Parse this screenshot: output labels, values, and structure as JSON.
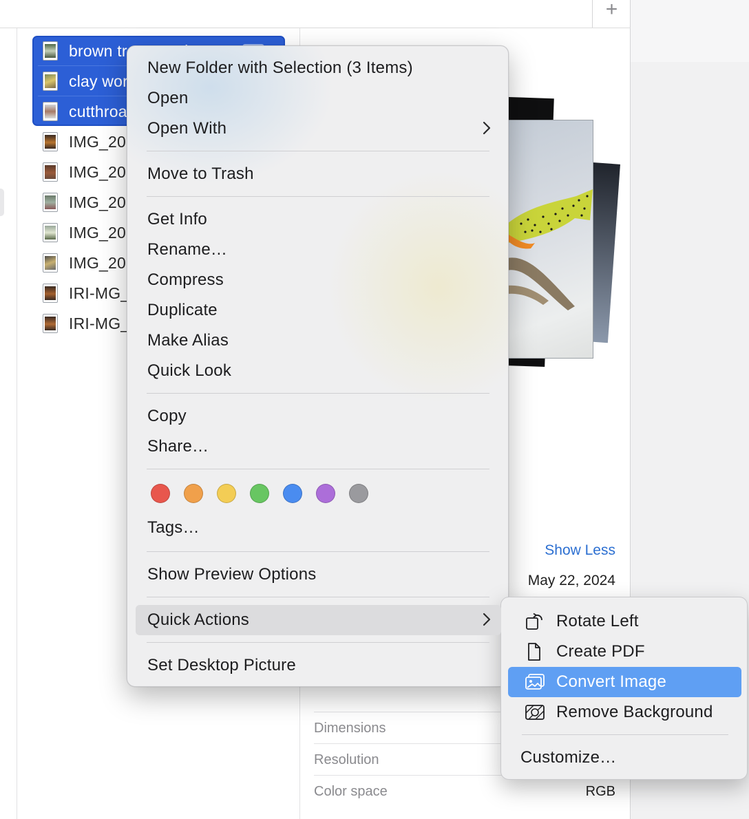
{
  "toolbar": {
    "add_label": "+"
  },
  "files": [
    {
      "name": "brown trout crush",
      "selected": true
    },
    {
      "name": "clay work",
      "selected": true
    },
    {
      "name": "cutthroat",
      "selected": true
    },
    {
      "name": "IMG_20",
      "selected": false
    },
    {
      "name": "IMG_20",
      "selected": false
    },
    {
      "name": "IMG_20",
      "selected": false
    },
    {
      "name": "IMG_20",
      "selected": false
    },
    {
      "name": "IMG_20",
      "selected": false
    },
    {
      "name": "IRI-MG_",
      "selected": false
    },
    {
      "name": "IRI-MG_",
      "selected": false
    }
  ],
  "context_menu": {
    "new_folder": "New Folder with Selection (3 Items)",
    "open": "Open",
    "open_with": "Open With",
    "move_to_trash": "Move to Trash",
    "get_info": "Get Info",
    "rename": "Rename…",
    "compress": "Compress",
    "duplicate": "Duplicate",
    "make_alias": "Make Alias",
    "quick_look": "Quick Look",
    "copy": "Copy",
    "share": "Share…",
    "tags": "Tags…",
    "show_preview_options": "Show Preview Options",
    "quick_actions": "Quick Actions",
    "set_desktop_picture": "Set Desktop Picture",
    "tag_colors": [
      {
        "name": "red",
        "color": "#e8574d"
      },
      {
        "name": "orange",
        "color": "#f0a04b"
      },
      {
        "name": "yellow",
        "color": "#f3cd55"
      },
      {
        "name": "green",
        "color": "#68c662"
      },
      {
        "name": "blue",
        "color": "#4a8cf0"
      },
      {
        "name": "purple",
        "color": "#ac6ed9"
      },
      {
        "name": "gray",
        "color": "#9a9a9e"
      }
    ]
  },
  "quick_actions_menu": {
    "rotate_left": "Rotate Left",
    "create_pdf": "Create PDF",
    "convert_image": "Convert Image",
    "remove_background": "Remove Background",
    "customize": "Customize…"
  },
  "preview": {
    "show_less": "Show Less",
    "date": "May 22, 2024",
    "meta": [
      {
        "label": "Dimensions",
        "value": ""
      },
      {
        "label": "Resolution",
        "value": ""
      },
      {
        "label": "Color space",
        "value": "RGB"
      }
    ]
  },
  "colors": {
    "selection": "#2c5fd6",
    "submenu_highlight": "#5f9ff3",
    "link": "#2c6fd1"
  }
}
